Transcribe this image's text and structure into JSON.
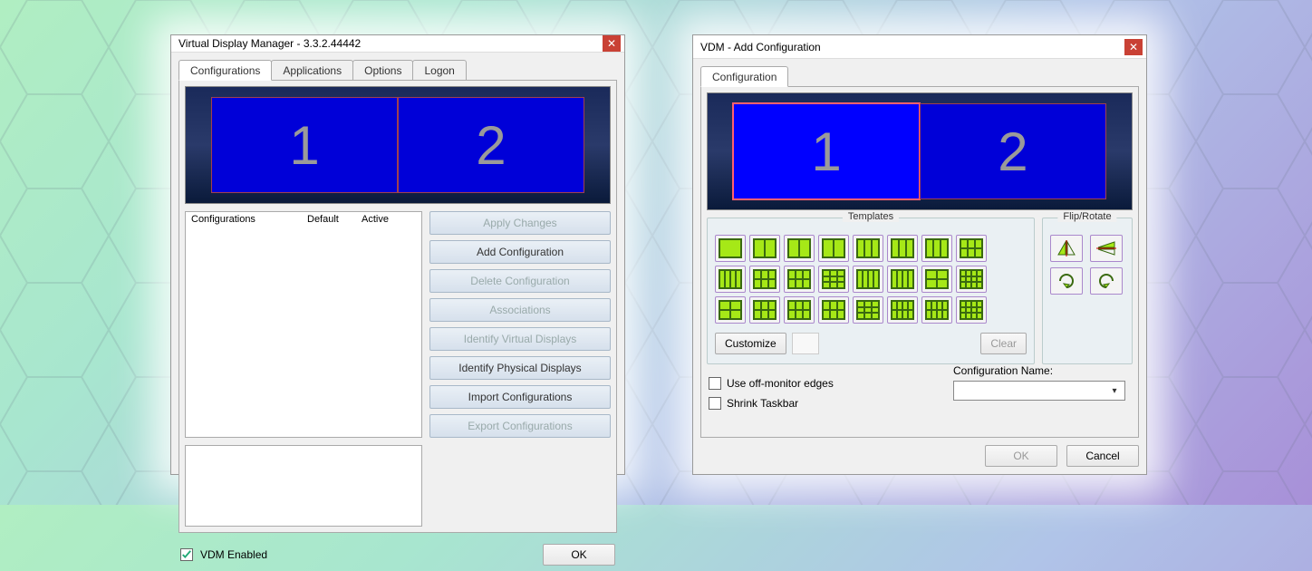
{
  "left": {
    "title": "Virtual Display Manager - 3.3.2.44442",
    "tabs": [
      "Configurations",
      "Applications",
      "Options",
      "Logon"
    ],
    "active_tab": 0,
    "preview": {
      "displays": [
        "1",
        "2"
      ]
    },
    "list_headers": [
      "Configurations",
      "Default",
      "Active"
    ],
    "buttons": {
      "apply": "Apply Changes",
      "add": "Add Configuration",
      "delete": "Delete Configuration",
      "assoc": "Associations",
      "identv": "Identify Virtual Displays",
      "identp": "Identify Physical Displays",
      "import": "Import Configurations",
      "export": "Export Configurations"
    },
    "vdm_enabled_label": "VDM Enabled",
    "vdm_enabled_checked": true,
    "ok": "OK"
  },
  "right": {
    "title": "VDM - Add Configuration",
    "tab": "Configuration",
    "preview": {
      "displays": [
        "1",
        "2"
      ],
      "selected": 0
    },
    "templates_label": "Templates",
    "flip_label": "Flip/Rotate",
    "customize": "Customize",
    "clear": "Clear",
    "use_off_label": "Use off-monitor edges",
    "shrink_label": "Shrink Taskbar",
    "cfg_name_label": "Configuration Name:",
    "cfg_name_value": "",
    "ok": "OK",
    "cancel": "Cancel",
    "templates": [
      {
        "cols": 1,
        "rows": 1
      },
      {
        "cols": 2,
        "rows": 1
      },
      {
        "cols": 2,
        "rows": 1,
        "asym": "l"
      },
      {
        "cols": 2,
        "rows": 1,
        "asym": "r"
      },
      {
        "cols": 3,
        "rows": 1
      },
      {
        "cols": 3,
        "rows": 1,
        "stack": "r"
      },
      {
        "cols": 3,
        "rows": 1,
        "stack": "l"
      },
      {
        "cols": 3,
        "rows": 2
      },
      {
        "cols": 4,
        "rows": 1
      },
      {
        "cols": 3,
        "rows": 2,
        "v": "a"
      },
      {
        "cols": 3,
        "rows": 2,
        "v": "b"
      },
      {
        "cols": 3,
        "rows": 3
      },
      {
        "cols": 4,
        "rows": 1,
        "v": "a"
      },
      {
        "cols": 4,
        "rows": 1,
        "v": "b"
      },
      {
        "cols": 2,
        "rows": 2
      },
      {
        "cols": 4,
        "rows": 3
      },
      {
        "cols": 2,
        "rows": 2,
        "v": "a"
      },
      {
        "cols": 3,
        "rows": 2,
        "v": "c"
      },
      {
        "cols": 3,
        "rows": 2,
        "v": "d"
      },
      {
        "cols": 3,
        "rows": 2,
        "v": "e"
      },
      {
        "cols": 3,
        "rows": 3,
        "v": "a"
      },
      {
        "cols": 4,
        "rows": 2,
        "v": "a"
      },
      {
        "cols": 4,
        "rows": 2,
        "v": "b"
      },
      {
        "cols": 4,
        "rows": 3,
        "v": "a"
      }
    ],
    "flip_icons": [
      "flip-horizontal-icon",
      "flip-vertical-icon",
      "rotate-cw-icon",
      "rotate-ccw-icon"
    ]
  }
}
